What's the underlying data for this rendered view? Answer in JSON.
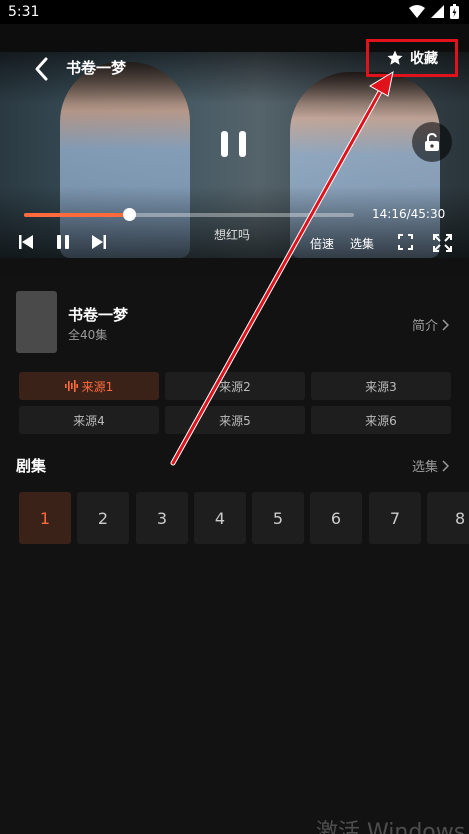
{
  "status_bar": {
    "time": "5:31"
  },
  "player": {
    "title": "书卷一梦",
    "favorite_label": "收藏",
    "subtitle": "想红吗",
    "time_display": "14:16/45:30",
    "progress": 0.317,
    "speed_label": "倍速",
    "episodes_label": "选集"
  },
  "drama": {
    "title": "书卷一梦",
    "episode_count": "全40集",
    "intro_label": "简介"
  },
  "sources": [
    {
      "label": "来源1",
      "active": true
    },
    {
      "label": "来源2",
      "active": false
    },
    {
      "label": "来源3",
      "active": false
    },
    {
      "label": "来源4",
      "active": false
    },
    {
      "label": "来源5",
      "active": false
    },
    {
      "label": "来源6",
      "active": false
    }
  ],
  "episodes_section": {
    "title": "剧集",
    "select_label": "选集",
    "items": [
      "1",
      "2",
      "3",
      "4",
      "5",
      "6",
      "7",
      "8"
    ]
  },
  "watermark": "激活 Windows",
  "colors": {
    "accent": "#ff6b3d",
    "annotation_red": "#e0121b"
  }
}
